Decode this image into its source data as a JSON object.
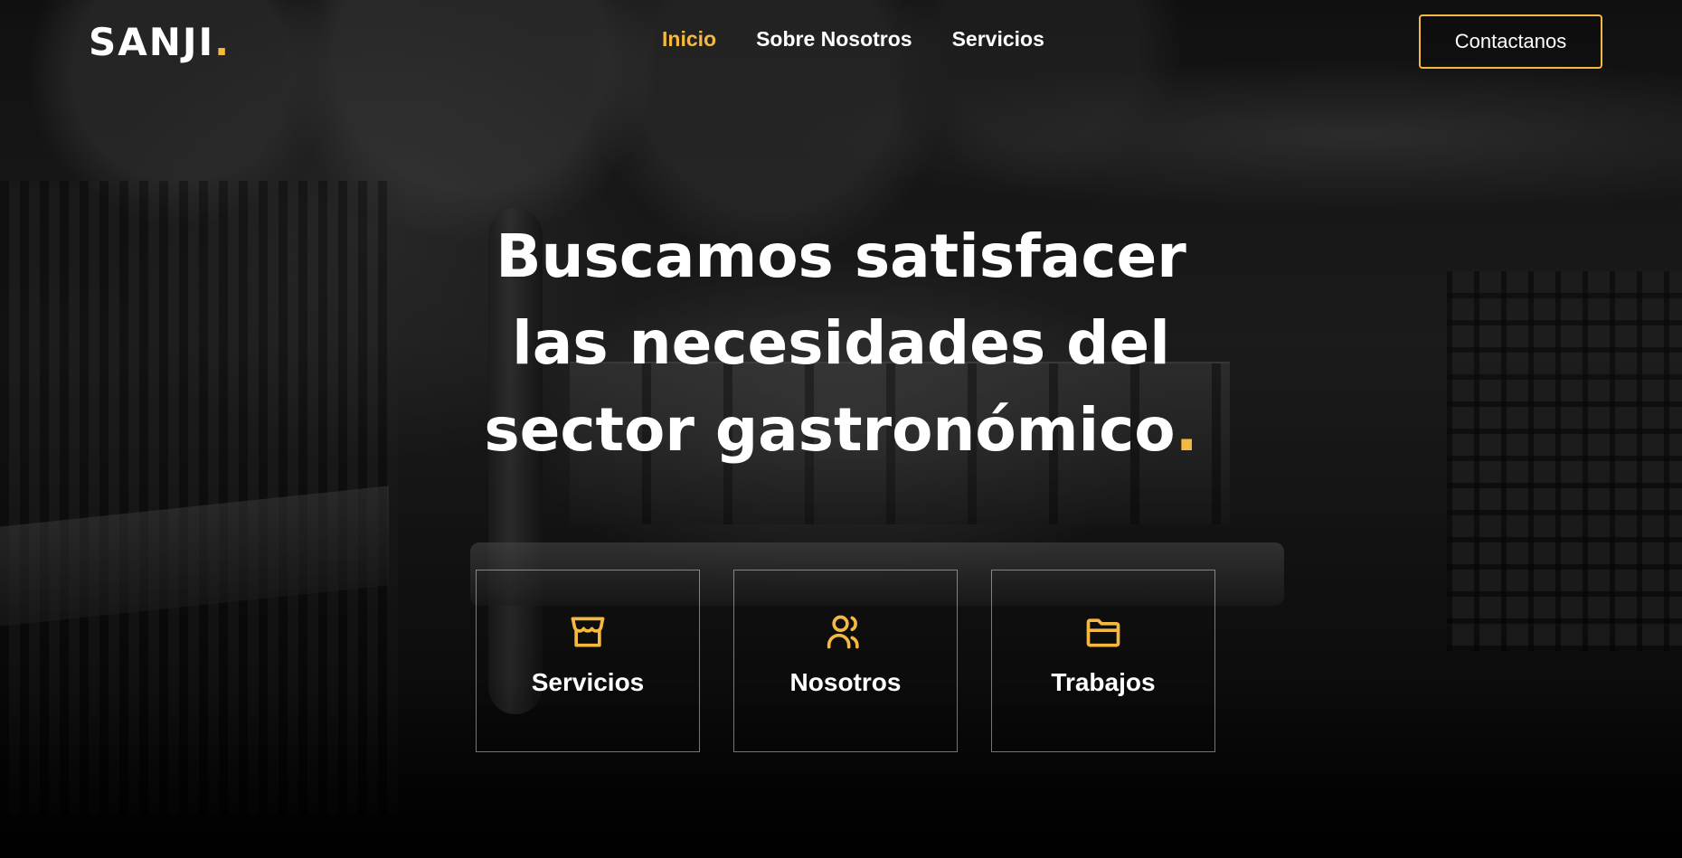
{
  "brand": {
    "name": "SANJI",
    "dot": "."
  },
  "nav": {
    "items": [
      {
        "label": "Inicio",
        "active": true
      },
      {
        "label": "Sobre Nosotros",
        "active": false
      },
      {
        "label": "Servicios",
        "active": false
      }
    ],
    "cta_label": "Contactanos"
  },
  "hero": {
    "line1": "Buscamos satisfacer",
    "line2": "las necesidades del",
    "line3": "sector gastronómico",
    "accent": "."
  },
  "cards": [
    {
      "label": "Servicios",
      "icon": "store-icon"
    },
    {
      "label": "Nosotros",
      "icon": "users-icon"
    },
    {
      "label": "Trabajos",
      "icon": "folder-icon"
    }
  ],
  "colors": {
    "accent": "#f5b942",
    "text": "#ffffff"
  }
}
